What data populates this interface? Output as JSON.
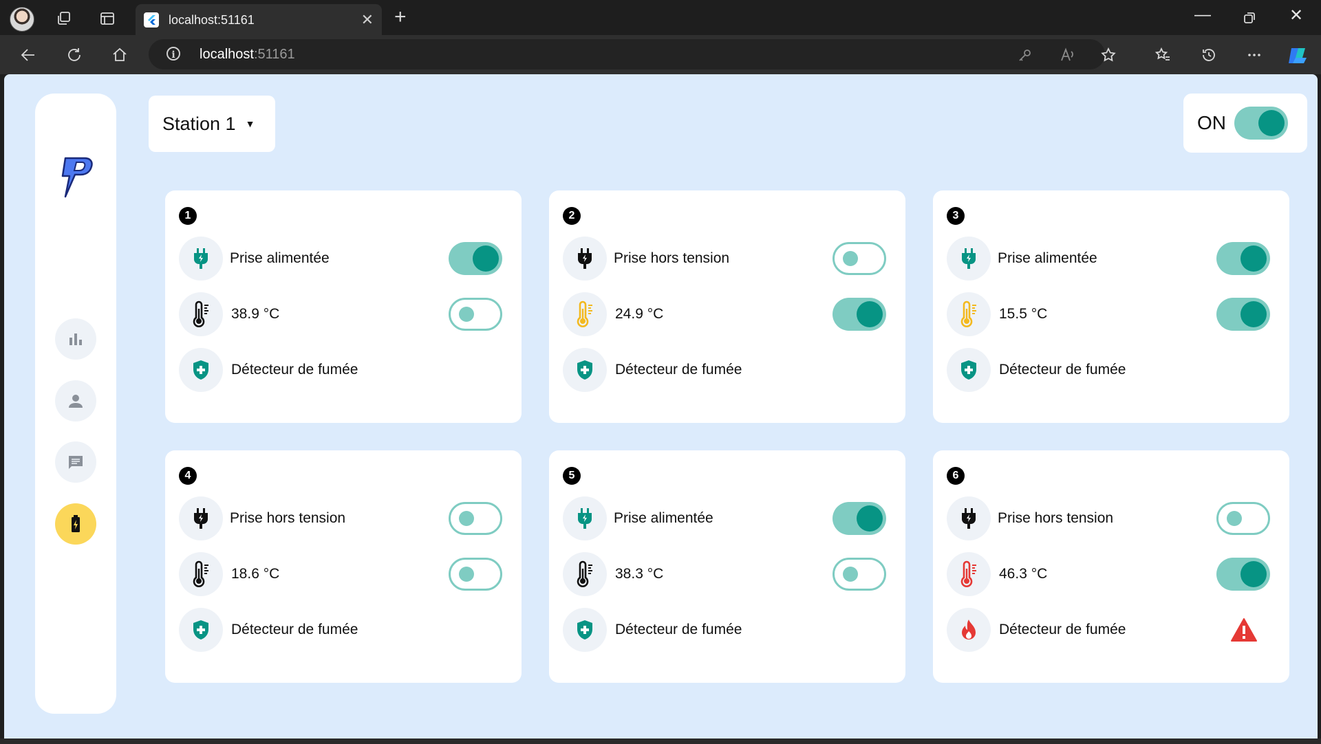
{
  "browser": {
    "tab_title": "localhost:51161",
    "url_host": "localhost",
    "url_port": ":51161"
  },
  "app": {
    "station_label": "Station 1",
    "power_label": "ON",
    "power_on": true,
    "sidebar": [
      "chart-icon",
      "person-icon",
      "message-icon",
      "battery-charging-icon"
    ]
  },
  "colors": {
    "background": "#dcebfc",
    "accent": "#079484",
    "toggle_track": "#7fccc2",
    "active_nav": "#fbd75a",
    "temp_normal": "#111111",
    "temp_warm": "#f3b91f",
    "temp_hot": "#e53935",
    "alert": "#e53935"
  },
  "cards": [
    {
      "number": "1",
      "plug_label": "Prise alimentée",
      "plug_on": true,
      "temp": "38.9 °C",
      "temp_level": "normal",
      "temp_on": false,
      "smoke_label": "Détecteur de fumée",
      "smoke_alert": false
    },
    {
      "number": "2",
      "plug_label": "Prise hors tension",
      "plug_on": false,
      "temp": "24.9 °C",
      "temp_level": "warm",
      "temp_on": true,
      "smoke_label": "Détecteur de fumée",
      "smoke_alert": false
    },
    {
      "number": "3",
      "plug_label": "Prise alimentée",
      "plug_on": true,
      "temp": "15.5 °C",
      "temp_level": "warm",
      "temp_on": true,
      "smoke_label": "Détecteur de fumée",
      "smoke_alert": false
    },
    {
      "number": "4",
      "plug_label": "Prise hors tension",
      "plug_on": false,
      "temp": "18.6 °C",
      "temp_level": "normal",
      "temp_on": false,
      "smoke_label": "Détecteur de fumée",
      "smoke_alert": false
    },
    {
      "number": "5",
      "plug_label": "Prise alimentée",
      "plug_on": true,
      "temp": "38.3 °C",
      "temp_level": "normal",
      "temp_on": false,
      "smoke_label": "Détecteur de fumée",
      "smoke_alert": false
    },
    {
      "number": "6",
      "plug_label": "Prise hors tension",
      "plug_on": false,
      "temp": "46.3 °C",
      "temp_level": "hot",
      "temp_on": true,
      "smoke_label": "Détecteur de fumée",
      "smoke_alert": true
    }
  ]
}
